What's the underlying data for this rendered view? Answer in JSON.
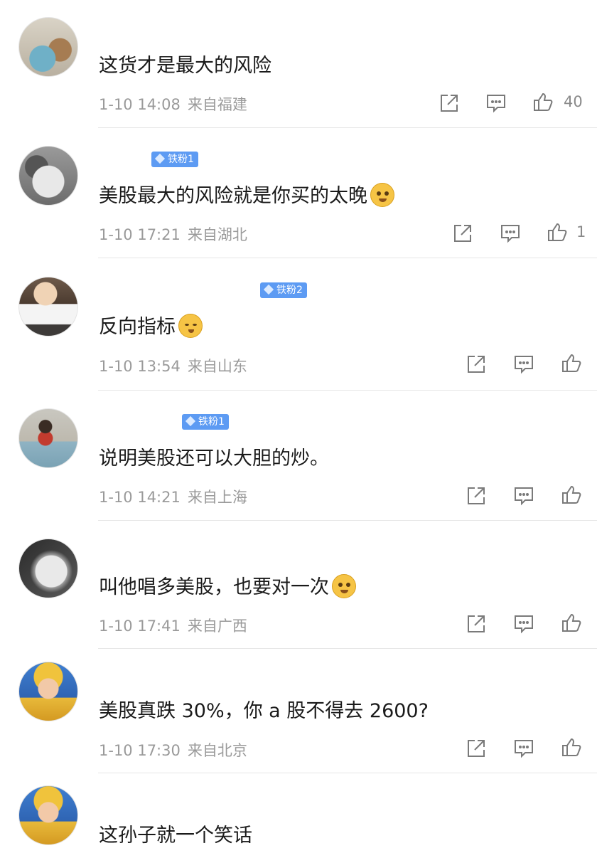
{
  "icons": {
    "share": "share-icon",
    "comment": "comment-icon",
    "like": "thumbs-up-icon"
  },
  "colors": {
    "badge": "#5d9bf3",
    "meta": "#9a9a9a",
    "icon": "#7a7a7a"
  },
  "comments": [
    {
      "username": "",
      "badge": "",
      "text": "这货才是最大的风险",
      "emoji": "",
      "time": "1-10 14:08",
      "location": "来自福建",
      "likes": "40"
    },
    {
      "username": "",
      "badge": "铁粉1",
      "text": "美股最大的风险就是你买的太晚",
      "emoji": "doge",
      "time": "1-10 17:21",
      "location": "来自湖北",
      "likes": "1"
    },
    {
      "username": "",
      "badge": "铁粉2",
      "text": "反向指标",
      "emoji": "shush",
      "time": "1-10 13:54",
      "location": "来自山东",
      "likes": ""
    },
    {
      "username": "",
      "badge": "铁粉1",
      "text": "说明美股还可以大胆的炒。",
      "emoji": "",
      "time": "1-10 14:21",
      "location": "来自上海",
      "likes": ""
    },
    {
      "username": "",
      "badge": "",
      "text": "叫他唱多美股，也要对一次",
      "emoji": "doge",
      "time": "1-10 17:41",
      "location": "来自广西",
      "likes": ""
    },
    {
      "username": "",
      "badge": "",
      "text": "美股真跌 30%，你 a 股不得去 2600?",
      "emoji": "",
      "time": "1-10 17:30",
      "location": "来自北京",
      "likes": ""
    },
    {
      "username": "",
      "badge": "",
      "text": "这孙子就一个笑话",
      "emoji": "",
      "time": "",
      "location": "",
      "likes": ""
    }
  ]
}
